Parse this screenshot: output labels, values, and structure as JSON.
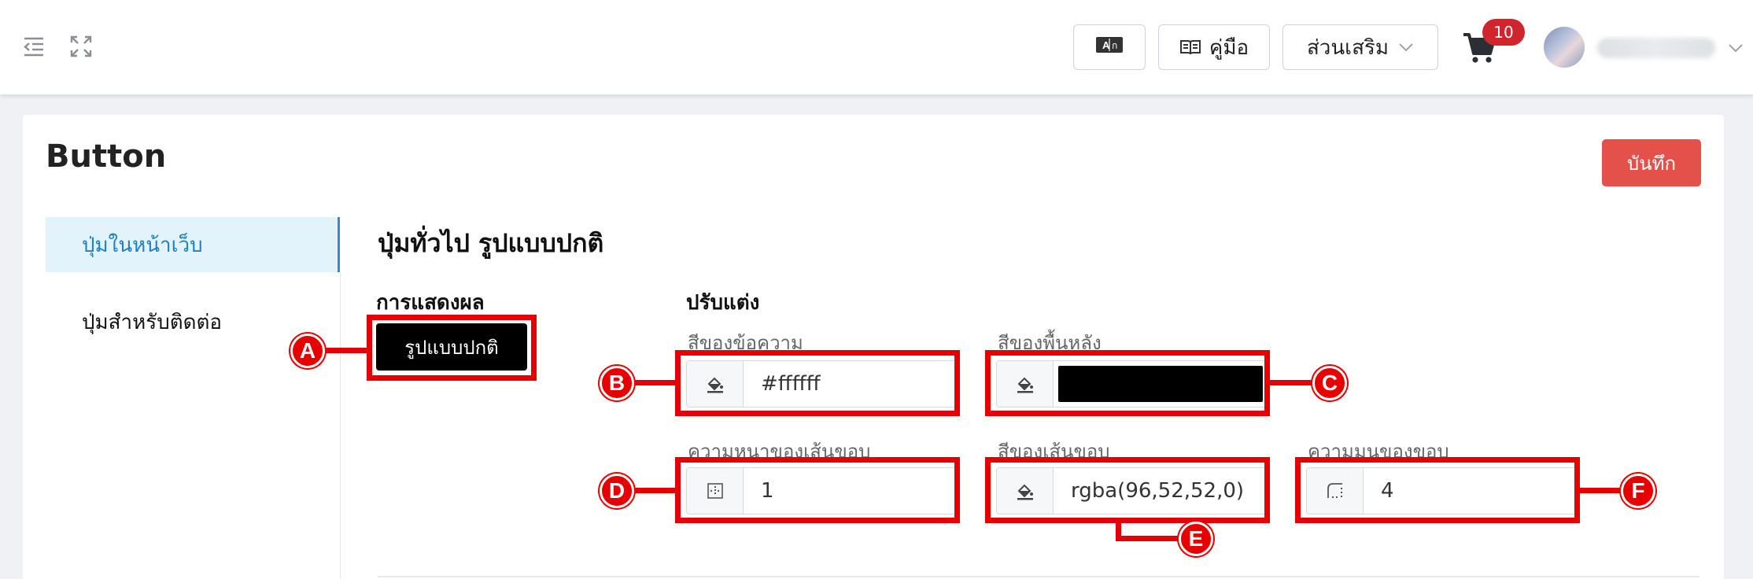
{
  "topbar": {
    "translate_label": "",
    "manual_label": "คู่มือ",
    "addons_label": "ส่วนเสริม",
    "cart_count": "10"
  },
  "page": {
    "title": "Button",
    "save_label": "บันทึก"
  },
  "sidebar": {
    "items": [
      {
        "label": "ปุ่มในหน้าเว็บ",
        "active": true
      },
      {
        "label": "ปุ่มสำหรับติดต่อ",
        "active": false
      }
    ]
  },
  "main": {
    "section_title": "ปุ่มทั่วไป รูปแบบปกติ",
    "display_heading": "การแสดงผล",
    "preview_label": "รูปแบบปกติ",
    "customize_heading": "ปรับแต่ง",
    "fields": {
      "text_color": {
        "label": "สีของข้อความ",
        "value": "#ffffff"
      },
      "background_color": {
        "label": "สีของพื้นหลัง",
        "value": "#000000"
      },
      "border_width": {
        "label": "ความหนาของเส้นขอบ",
        "value": "1"
      },
      "border_color": {
        "label": "สีของเส้นขอบ",
        "value": "rgba(96,52,52,0)"
      },
      "border_radius": {
        "label": "ความมนของขอบ",
        "value": "4"
      }
    }
  },
  "annotations": {
    "a": "A",
    "b": "B",
    "c": "C",
    "d": "D",
    "e": "E",
    "f": "F",
    "color": "#e60000"
  },
  "colors": {
    "accent_blue": "#1d7fc4",
    "save_red": "#e4514a",
    "badge_red": "#d0252c"
  }
}
